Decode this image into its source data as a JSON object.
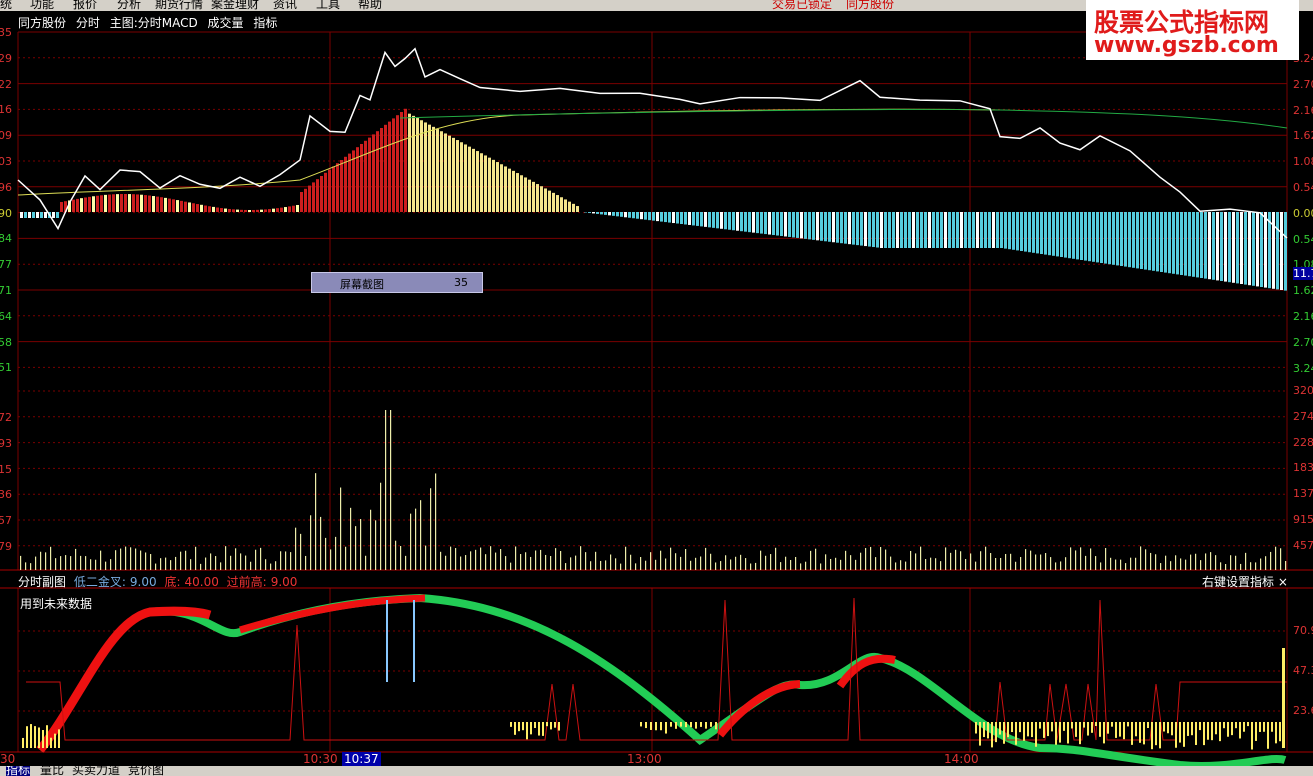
{
  "menu": {
    "items": [
      "统",
      "功能",
      "报价",
      "分析",
      "期货行情",
      "案金理财",
      "资讯",
      "工具",
      "帮助"
    ],
    "status": [
      "交易已锁定",
      "同方股份"
    ]
  },
  "header": {
    "stock": "同方股份",
    "period": "分时",
    "main_chart": "主图:分时MACD",
    "volume": "成交量",
    "indicator": "指标"
  },
  "watermark": {
    "line1": "股票公式指标网",
    "line2": "www.gszb.com"
  },
  "axes": {
    "left_price": [
      "35",
      "29",
      "22",
      "16",
      "09",
      "03",
      "96",
      "90",
      "84",
      "77",
      "71",
      "64",
      "58",
      "51"
    ],
    "left_volume": [
      "72",
      "93",
      "15",
      "36",
      "57",
      "79"
    ],
    "right_price": [
      "3.24",
      "2.70",
      "2.16",
      "1.62",
      "1.08",
      "0.54",
      "0.00",
      "0.54",
      "1.08",
      "1.62",
      "2.16",
      "2.70",
      "3.24"
    ],
    "right_volume": [
      "320",
      "274",
      "228",
      "183",
      "137",
      "915",
      "457"
    ],
    "right_sub": [
      "70.9",
      "47.3",
      "23.6"
    ],
    "right_label": "11.7"
  },
  "popup": {
    "label": "屏幕截图",
    "value": "35"
  },
  "sub_chart": {
    "title": "分时副图",
    "k1": "低二金叉:",
    "v1": "9.00",
    "k2": "底:",
    "v2": "40.00",
    "k3": "过前高:",
    "v3": "9.00",
    "note": "用到未来数据",
    "right": "右键设置指标 ×"
  },
  "time_axis": [
    "30",
    "10:30",
    "10:37",
    "13:00",
    "14:00"
  ],
  "bottom_tabs": [
    "指标",
    "量比",
    "买卖力道",
    "竞价图"
  ],
  "colors": {
    "price_line": "#ffffff",
    "avg_line": "#ffff66",
    "grid": "#8b0000",
    "up": "#d81e1e",
    "down": "#55ccdd",
    "vol": "#ffffaa",
    "green_band": "#22cc55",
    "red_band": "#ee1111"
  }
}
